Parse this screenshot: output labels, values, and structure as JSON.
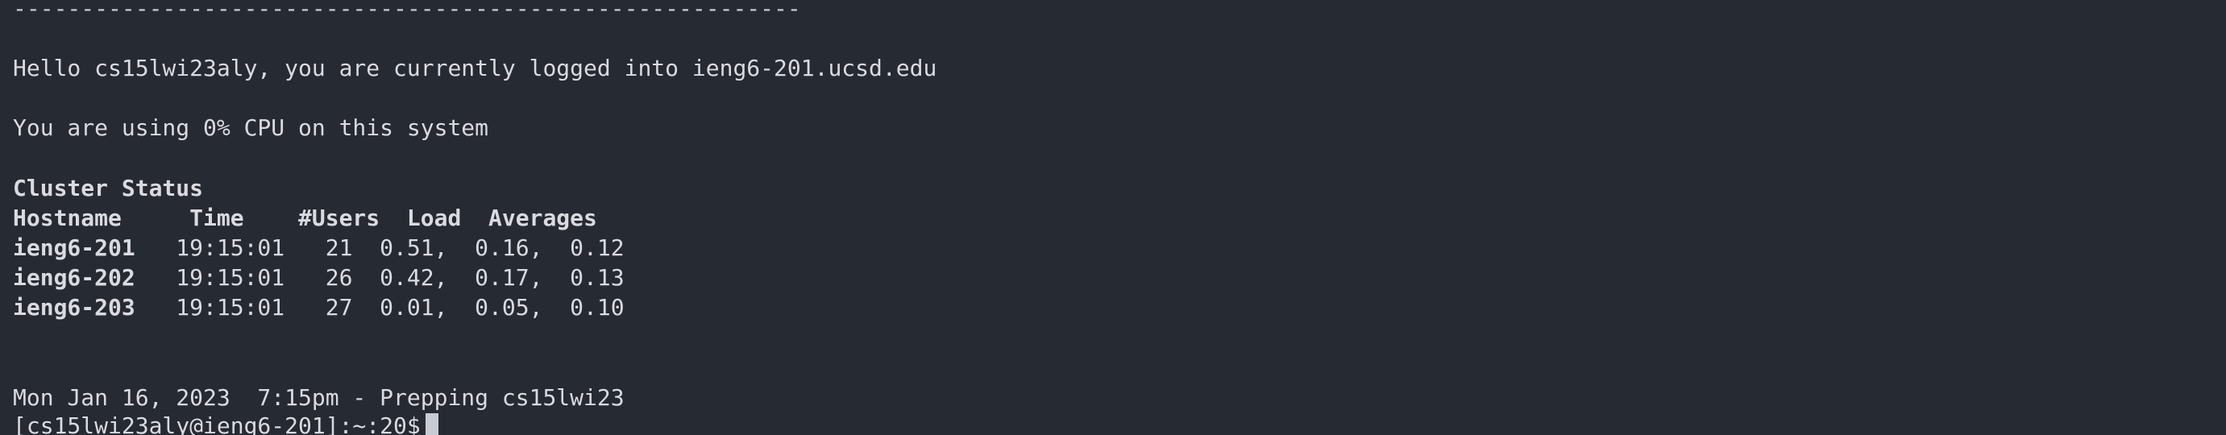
{
  "terminal": {
    "separator": "----------------------------------------------------------",
    "greeting": "Hello cs15lwi23aly, you are currently logged into ieng6-201.ucsd.edu",
    "cpu_usage": "You are using 0% CPU on this system",
    "cluster_title": "Cluster Status",
    "header_row": "Hostname     Time    #Users  Load  Averages",
    "rows": [
      {
        "host": "ieng6-201",
        "rest": "   19:15:01   21  0.51,  0.16,  0.12"
      },
      {
        "host": "ieng6-202",
        "rest": "   19:15:01   26  0.42,  0.17,  0.13"
      },
      {
        "host": "ieng6-203",
        "rest": "   19:15:01   27  0.01,  0.05,  0.10"
      }
    ],
    "message": "Mon Jan 16, 2023  7:15pm - Prepping cs15lwi23",
    "prompt": "[cs15lwi23aly@ieng6-201]:~:20$"
  }
}
